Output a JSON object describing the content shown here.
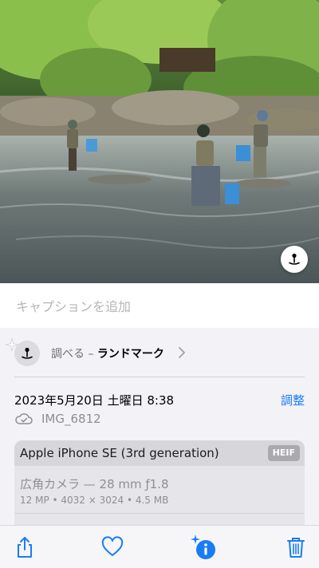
{
  "photo": {
    "description_icon": "visual-lookup-landmark-icon"
  },
  "caption": {
    "placeholder": "キャプションを追加"
  },
  "lookup": {
    "prefix": "調べる – ",
    "value": "ランドマーク",
    "icon": "landmark-icon"
  },
  "metadata": {
    "datetime": "2023年5月20日 土曜日 8:38",
    "adjust_label": "調整",
    "filename": "IMG_6812",
    "cloud_icon": "icloud-synced-icon"
  },
  "camera": {
    "device": "Apple iPhone SE (3rd generation)",
    "format": "HEIF",
    "lens": "広角カメラ — 28 mm ƒ1.8",
    "specs": "12 MP • 4032 × 3024 • 4.5 MB"
  },
  "toolbar": {
    "share_icon": "share-icon",
    "favorite_icon": "heart-icon",
    "info_icon": "info-sparkle-icon",
    "delete_icon": "trash-icon"
  },
  "colors": {
    "accent": "#1a7cf5",
    "background": "#f2f2f7"
  }
}
